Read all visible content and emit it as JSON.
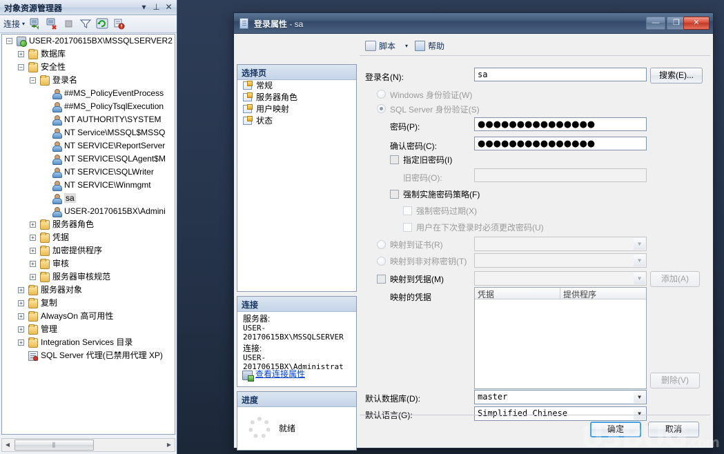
{
  "object_explorer": {
    "title": "对象资源管理器",
    "titlebar_buttons": {
      "dropdown": "▾",
      "pin": "⊥",
      "close": "✕"
    },
    "toolbar": {
      "connect_label": "连接",
      "caret": "▾",
      "icons": [
        "connect-object-explorer-icon",
        "disconnect-object-explorer-icon",
        "stop-icon",
        "filter-icon",
        "refresh-icon",
        "script-error-icon"
      ]
    },
    "tree": [
      {
        "label": "USER-20170615BX\\MSSQLSERVER2",
        "indent": 0,
        "expander": "−",
        "icon": "server-icon"
      },
      {
        "label": "数据库",
        "indent": 1,
        "expander": "+",
        "icon": "folder-icon"
      },
      {
        "label": "安全性",
        "indent": 1,
        "expander": "−",
        "icon": "folder-icon"
      },
      {
        "label": "登录名",
        "indent": 2,
        "expander": "−",
        "icon": "folder-icon"
      },
      {
        "label": "##MS_PolicyEventProcess",
        "indent": 3,
        "expander": "",
        "icon": "login-disabled-icon"
      },
      {
        "label": "##MS_PolicyTsqlExecution",
        "indent": 3,
        "expander": "",
        "icon": "login-disabled-icon"
      },
      {
        "label": "NT AUTHORITY\\SYSTEM",
        "indent": 3,
        "expander": "",
        "icon": "login-icon"
      },
      {
        "label": "NT Service\\MSSQL$MSSQ",
        "indent": 3,
        "expander": "",
        "icon": "login-icon"
      },
      {
        "label": "NT SERVICE\\ReportServer",
        "indent": 3,
        "expander": "",
        "icon": "login-icon"
      },
      {
        "label": "NT SERVICE\\SQLAgent$M",
        "indent": 3,
        "expander": "",
        "icon": "login-icon"
      },
      {
        "label": "NT SERVICE\\SQLWriter",
        "indent": 3,
        "expander": "",
        "icon": "login-icon"
      },
      {
        "label": "NT SERVICE\\Winmgmt",
        "indent": 3,
        "expander": "",
        "icon": "login-icon"
      },
      {
        "label": "sa",
        "indent": 3,
        "expander": "",
        "icon": "login-icon",
        "selected": true
      },
      {
        "label": "USER-20170615BX\\Admini",
        "indent": 3,
        "expander": "",
        "icon": "login-icon"
      },
      {
        "label": "服务器角色",
        "indent": 2,
        "expander": "+",
        "icon": "folder-icon"
      },
      {
        "label": "凭据",
        "indent": 2,
        "expander": "+",
        "icon": "folder-icon"
      },
      {
        "label": "加密提供程序",
        "indent": 2,
        "expander": "+",
        "icon": "folder-icon"
      },
      {
        "label": "审核",
        "indent": 2,
        "expander": "+",
        "icon": "folder-icon"
      },
      {
        "label": "服务器审核规范",
        "indent": 2,
        "expander": "+",
        "icon": "folder-icon"
      },
      {
        "label": "服务器对象",
        "indent": 1,
        "expander": "+",
        "icon": "folder-icon"
      },
      {
        "label": "复制",
        "indent": 1,
        "expander": "+",
        "icon": "folder-icon"
      },
      {
        "label": "AlwaysOn 高可用性",
        "indent": 1,
        "expander": "+",
        "icon": "folder-icon"
      },
      {
        "label": "管理",
        "indent": 1,
        "expander": "+",
        "icon": "folder-icon"
      },
      {
        "label": "Integration Services 目录",
        "indent": 1,
        "expander": "+",
        "icon": "folder-icon"
      },
      {
        "label": "SQL Server 代理(已禁用代理 XP)",
        "indent": 1,
        "expander": "",
        "icon": "sql-agent-disabled-icon"
      }
    ],
    "hscroll": {
      "left_arrow": "◀",
      "right_arrow": "▶",
      "thumb_grip": "⫼"
    }
  },
  "dialog": {
    "title_main": "登录属性",
    "title_sub": " - sa",
    "window_buttons": {
      "minimize": "—",
      "maximize": "❐",
      "close": "✕"
    },
    "toolbar": {
      "script_label": "脚本",
      "script_caret": "▾",
      "help_label": "帮助"
    },
    "select_page": {
      "header": "选择页",
      "items": [
        {
          "label": "常规"
        },
        {
          "label": "服务器角色"
        },
        {
          "label": "用户映射"
        },
        {
          "label": "状态"
        }
      ]
    },
    "connection": {
      "header": "连接",
      "server_label": "服务器:",
      "server_value": "USER-20170615BX\\MSSQLSERVER",
      "conn_label": "连接:",
      "conn_value": "USER-20170615BX\\Administrat",
      "link": "查看连接属性"
    },
    "progress": {
      "header": "进度",
      "status": "就绪"
    },
    "general": {
      "login_name_label": "登录名(N):",
      "login_name_value": "sa",
      "search_button": "搜索(E)...",
      "windows_auth_label": "Windows 身份验证(W)",
      "sql_auth_label": "SQL Server 身份验证(S)",
      "password_label": "密码(P):",
      "password_value": "●●●●●●●●●●●●●●●",
      "confirm_password_label": "确认密码(C):",
      "confirm_password_value": "●●●●●●●●●●●●●●●",
      "specify_old_password_label": "指定旧密码(I)",
      "old_password_label": "旧密码(O):",
      "old_password_value": "",
      "enforce_policy_label": "强制实施密码策略(F)",
      "enforce_expiration_label": "强制密码过期(X)",
      "must_change_label": "用户在下次登录时必须更改密码(U)",
      "map_certificate_label": "映射到证书(R)",
      "map_certificate_value": "",
      "map_asymmetric_label": "映射到非对称密钥(T)",
      "map_asymmetric_value": "",
      "map_credential_label": "映射到凭据(M)",
      "map_credential_value": "",
      "add_button": "添加(A)",
      "mapped_credentials_label": "映射的凭据",
      "credential_columns": [
        "凭据",
        "提供程序"
      ],
      "credential_rows": [],
      "remove_button": "删除(V)",
      "default_db_label": "默认数据库(D):",
      "default_db_value": "master",
      "default_lang_label": "默认语言(G):",
      "default_lang_value": "Simplified Chinese"
    },
    "buttons": {
      "ok": "确定",
      "cancel": "取消"
    }
  },
  "watermark": {
    "text": "U3BUG",
    "suffix": ".com"
  }
}
